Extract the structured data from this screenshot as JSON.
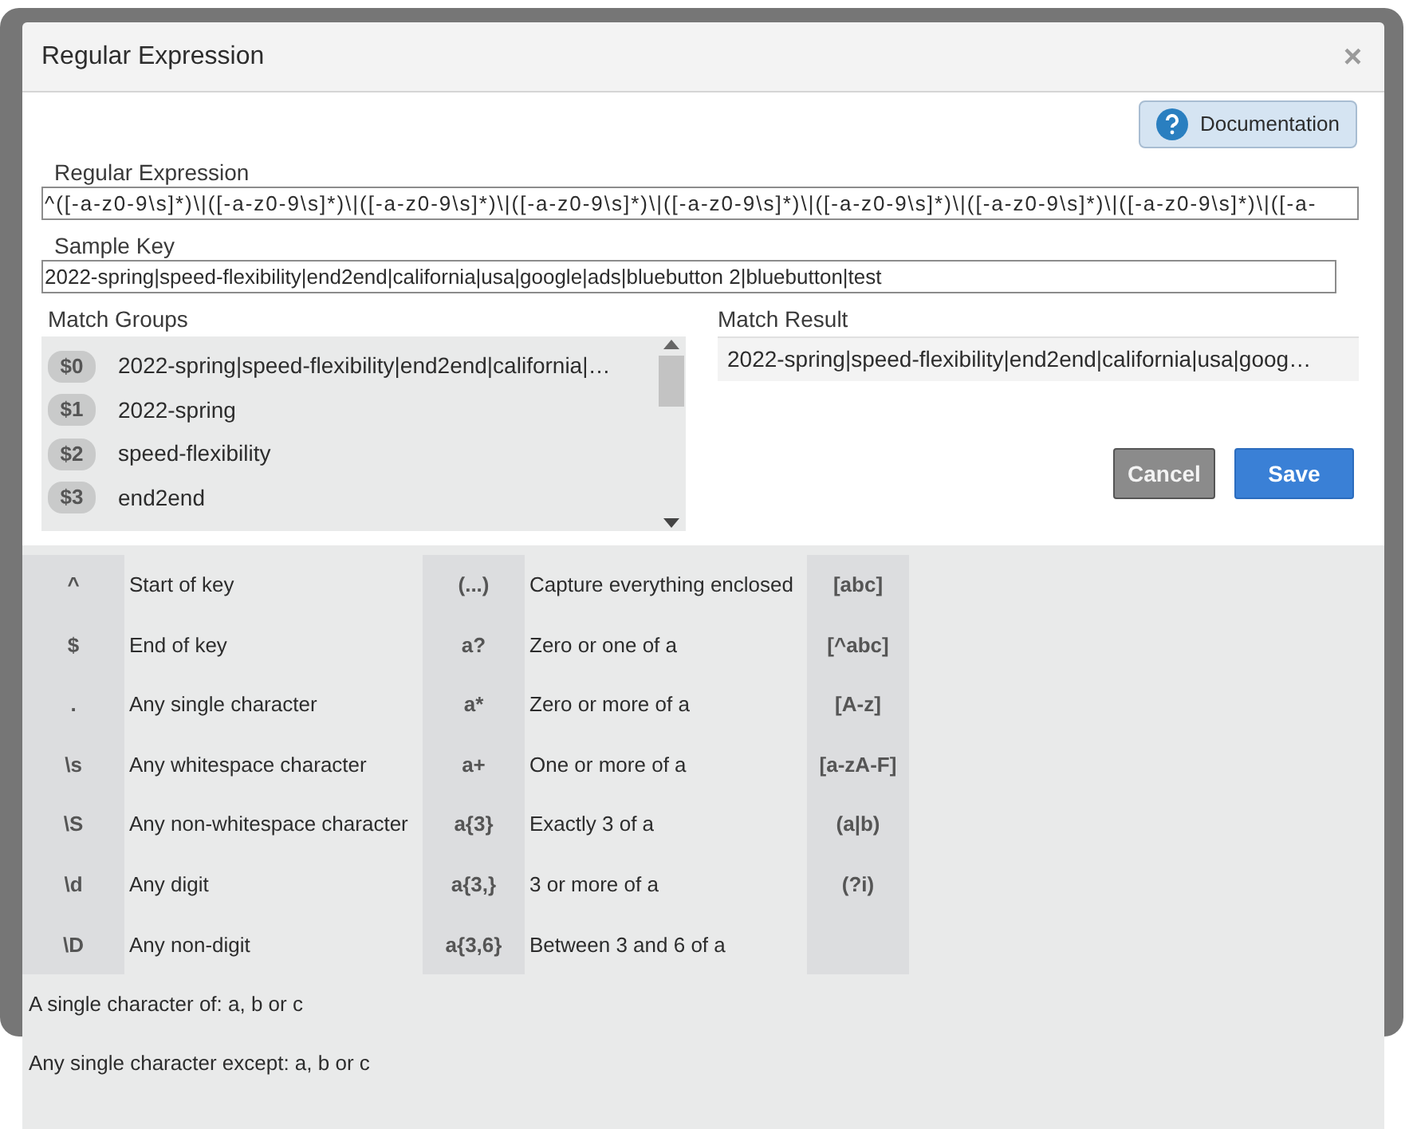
{
  "dialog": {
    "title": "Regular Expression",
    "close": "×"
  },
  "documentation_button": "Documentation",
  "regular_expression": {
    "label": "Regular Expression",
    "value": "^([-a-z0-9\\s]*)\\|([-a-z0-9\\s]*)\\|([-a-z0-9\\s]*)\\|([-a-z0-9\\s]*)\\|([-a-z0-9\\s]*)\\|([-a-z0-9\\s]*)\\|([-a-z0-9\\s]*)\\|([-a-z0-9\\s]*)\\|([-a-"
  },
  "sample_key": {
    "label": "Sample Key",
    "value": "2022-spring|speed-flexibility|end2end|california|usa|google|ads|bluebutton 2|bluebutton|test"
  },
  "match_groups": {
    "label": "Match Groups",
    "items": [
      {
        "tag": "$0",
        "value": "2022-spring|speed-flexibility|end2end|california|…"
      },
      {
        "tag": "$1",
        "value": "2022-spring"
      },
      {
        "tag": "$2",
        "value": "speed-flexibility"
      },
      {
        "tag": "$3",
        "value": "end2end"
      }
    ]
  },
  "match_result": {
    "label": "Match Result",
    "value": "2022-spring|speed-flexibility|end2end|california|usa|goog…"
  },
  "buttons": [
    {
      "label": "Cancel",
      "kind": "secondary"
    },
    {
      "label": "Save",
      "kind": "primary"
    }
  ],
  "reference": [
    {
      "symbol_1": "^",
      "meaning_1": "Start of key",
      "symbol_2": "(...)",
      "meaning_2": "Capture everything enclosed",
      "symbol_3": "[abc]"
    },
    {
      "symbol_1": "$",
      "meaning_1": "End of key",
      "symbol_2": "a?",
      "meaning_2": "Zero or one of a",
      "symbol_3": "[^abc]"
    },
    {
      "symbol_1": ".",
      "meaning_1": "Any single character",
      "symbol_2": "a*",
      "meaning_2": "Zero or more of a",
      "symbol_3": "[A-z]"
    },
    {
      "symbol_1": "\\s",
      "meaning_1": "Any whitespace character",
      "symbol_2": "a+",
      "meaning_2": "One or more of a",
      "symbol_3": "[a-zA-F]"
    },
    {
      "symbol_1": "\\S",
      "meaning_1": "Any non-whitespace character",
      "symbol_2": "a{3}",
      "meaning_2": "Exactly 3 of a",
      "symbol_3": "(a|b)"
    },
    {
      "symbol_1": "\\d",
      "meaning_1": "Any digit",
      "symbol_2": "a{3,}",
      "meaning_2": "3 or more of a",
      "symbol_3": "(?i)"
    },
    {
      "symbol_1": "\\D",
      "meaning_1": "Any non-digit",
      "symbol_2": "a{3,6}",
      "meaning_2": "Between 3 and 6 of a"
    }
  ],
  "reference_notes": [
    "A single character of: a, b or c",
    "Any single character except: a, b or c"
  ]
}
